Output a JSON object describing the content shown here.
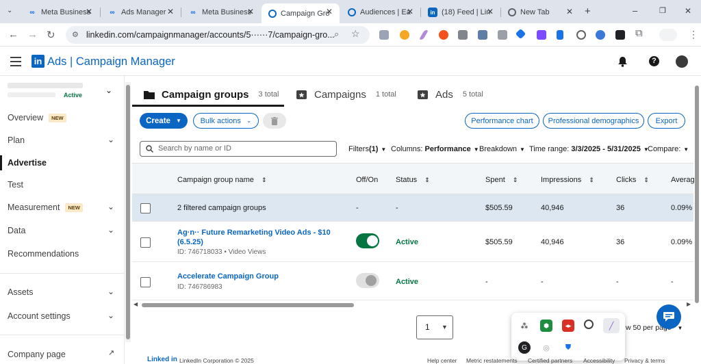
{
  "browser": {
    "tabs": [
      {
        "label": "Meta Business",
        "icon": "meta-icon"
      },
      {
        "label": "Ads Manager",
        "icon": "meta-icon"
      },
      {
        "label": "Meta Business",
        "icon": "meta-icon"
      },
      {
        "label": "Campaign Gro",
        "icon": "linkedin-campaign-icon",
        "active": true
      },
      {
        "label": "Audiences | Ea",
        "icon": "linkedin-campaign-icon"
      },
      {
        "label": "(18) Feed | Lin",
        "icon": "linkedin-icon"
      },
      {
        "label": "New Tab",
        "icon": "chrome-icon"
      }
    ],
    "new_tab": "+",
    "window_controls": [
      "–",
      "❐",
      "✕"
    ],
    "url": "linkedin.com/campaignmanager/accounts/5······7/campaign-gro..."
  },
  "app": {
    "logo_text": "in",
    "title": "Ads | Campaign Manager"
  },
  "sidebar": {
    "account_status": "Active",
    "items": [
      {
        "label": "Overview",
        "badge": "NEW"
      },
      {
        "label": "Plan",
        "chevron": true
      },
      {
        "label": "Advertise",
        "active": true
      },
      {
        "label": "Test"
      },
      {
        "label": "Measurement",
        "badge": "NEW",
        "chevron": true
      },
      {
        "label": "Data",
        "chevron": true
      },
      {
        "label": "Recommendations"
      },
      {
        "label": "Assets",
        "chevron": true
      },
      {
        "label": "Account settings",
        "chevron": true
      },
      {
        "label": "Company page"
      }
    ]
  },
  "main_tabs": [
    {
      "label": "Campaign groups",
      "count": "3 total",
      "active": true
    },
    {
      "label": "Campaigns",
      "count": "1 total"
    },
    {
      "label": "Ads",
      "count": "5 total"
    }
  ],
  "toolbar": {
    "create": "Create",
    "bulk_actions": "Bulk actions",
    "performance_chart": "Performance chart",
    "professional_demographics": "Professional demographics",
    "export": "Export"
  },
  "search": {
    "placeholder": "Search by name or ID"
  },
  "filters": {
    "filters": "Filters",
    "filters_count": "(1)",
    "columns_label": "Columns:",
    "columns_value": "Performance",
    "breakdown": "Breakdown",
    "time_range_label": "Time range:",
    "time_range_value": "3/3/2025 - 5/31/2025",
    "compare": "Compare:"
  },
  "table": {
    "columns": [
      "Campaign group name",
      "Off/On",
      "Status",
      "Spent",
      "Impressions",
      "Clicks",
      "Averag"
    ],
    "summary": {
      "name": "2 filtered campaign groups",
      "offon": "-",
      "status": "-",
      "spent": "$505.59",
      "impressions": "40,946",
      "clicks": "36",
      "avg": "0.09%"
    },
    "rows": [
      {
        "name_line1": "Ag·n·· Future Remarketing Video Ads - $10",
        "name_line2": "(6.5.25)",
        "meta": "ID: 746718033 • Video Views",
        "on": true,
        "status": "Active",
        "spent": "$505.59",
        "impressions": "40,946",
        "clicks": "36",
        "avg": "0.09%"
      },
      {
        "name_line1": "Accelerate Campaign Group",
        "meta": "ID: 746786983",
        "on": false,
        "status": "Active",
        "spent": "-",
        "impressions": "-",
        "clicks": "-",
        "avg": "-"
      }
    ]
  },
  "pagination": {
    "page": "1",
    "per_page": "w 50 per page"
  },
  "footer": {
    "logo": "Linked in",
    "corp": "LinkedIn Corporation © 2025",
    "links": [
      "Help center",
      "Metric restatements",
      "Certified partners",
      "Accessibility",
      "Privacy & terms"
    ]
  },
  "colors": {
    "brand": "#0a66c2",
    "active_green": "#057642",
    "toggle_on": "#057642"
  }
}
